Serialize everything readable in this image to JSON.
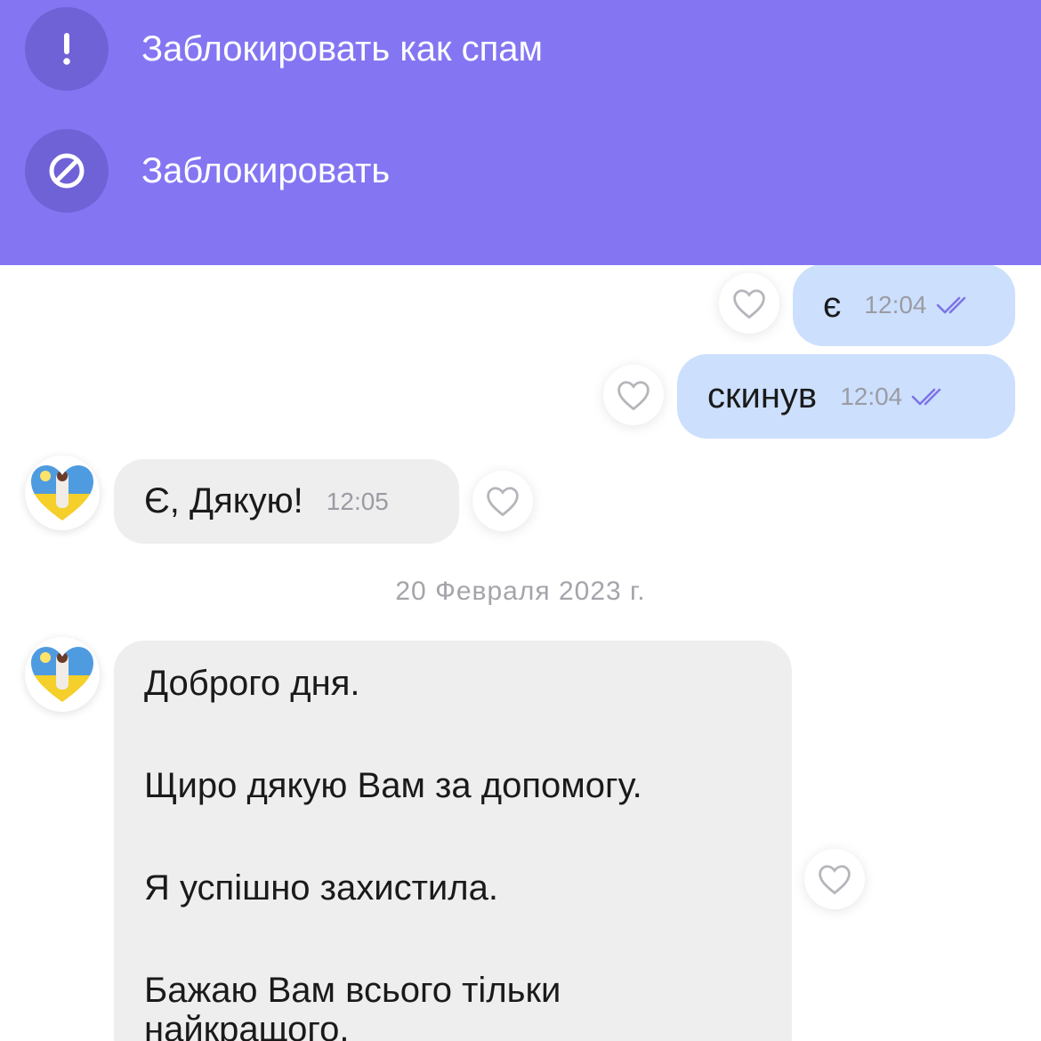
{
  "banner": {
    "color": "#8476F2",
    "spam_icon": "exclamation-icon",
    "spam_label": "Заблокировать как спам",
    "block_icon": "block-icon",
    "block_label": "Заблокировать"
  },
  "messages": [
    {
      "direction": "outgoing",
      "text": "є",
      "time": "12:04",
      "status": "read"
    },
    {
      "direction": "outgoing",
      "text": "скинув",
      "time": "12:04",
      "status": "read"
    },
    {
      "direction": "incoming",
      "text": "Є, Дякую!",
      "time": "12:05"
    }
  ],
  "date_separator": "20 Февраля 2023 г.",
  "long_message": {
    "direction": "incoming",
    "paragraphs": [
      "Доброго дня.",
      "Щиро дякую Вам за допомогу.",
      "Я успішно захистила.",
      "Бажаю Вам всього тільки",
      "найкращого."
    ]
  },
  "colors": {
    "outgoing_bubble": "#CCE0FD",
    "incoming_bubble": "#EEEEEF",
    "read_check": "#7F73E8"
  }
}
